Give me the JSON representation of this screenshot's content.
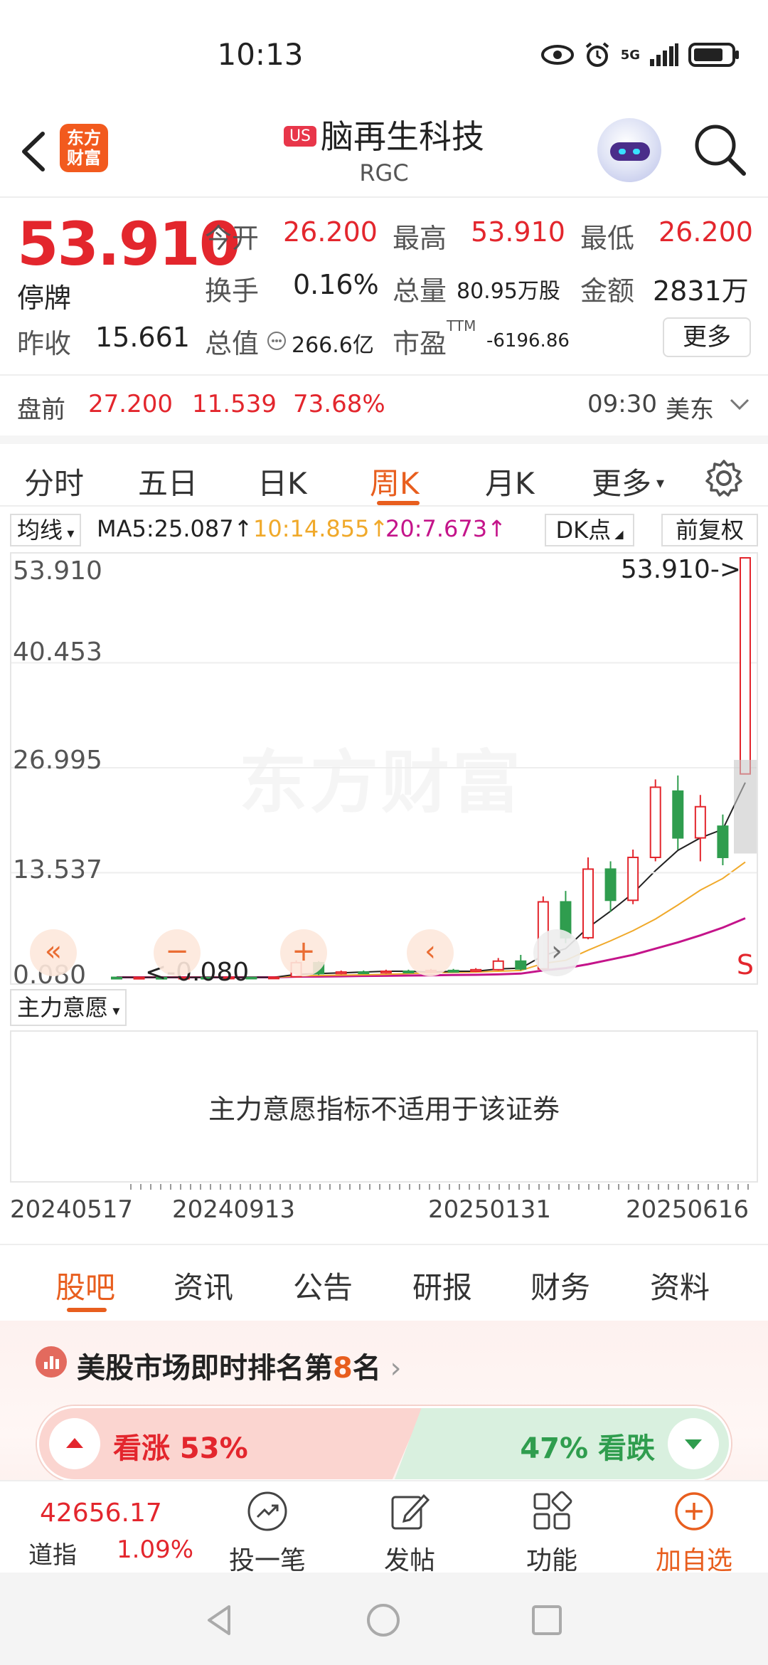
{
  "status": {
    "time": "10:13",
    "network": "5G"
  },
  "header": {
    "logo_text": "东方财富",
    "market_badge": "US",
    "name": "脑再生科技",
    "code": "RGC"
  },
  "quote": {
    "price": "53.910",
    "status": "停牌",
    "prev_close_label": "昨收",
    "prev_close": "15.661",
    "open_label": "今开",
    "open": "26.200",
    "high_label": "最高",
    "high": "53.910",
    "low_label": "最低",
    "low": "26.200",
    "turnover_label": "换手",
    "turnover": "0.16%",
    "volume_label": "总量",
    "volume": "80.95万股",
    "amount_label": "金额",
    "amount": "2831万",
    "mktcap_label": "总值",
    "mktcap": "266.6亿",
    "pe_label": "市盈",
    "pe_sup": "TTM",
    "pe": "-6196.86",
    "more": "更多"
  },
  "premarket": {
    "label": "盘前",
    "price": "27.200",
    "change": "11.539",
    "pct": "73.68%",
    "time": "09:30",
    "zone": "美东"
  },
  "period_tabs": [
    "分时",
    "五日",
    "日K",
    "周K",
    "月K",
    "更多"
  ],
  "ma": {
    "type": "均线",
    "ma5": "MA5:25.087↑",
    "ma10": "10:14.855↑",
    "ma20": "20:7.673↑",
    "dk": "DK点",
    "adjust": "前复权"
  },
  "chart_labels": {
    "watermark": "东方财富",
    "high_anno": "53.910->",
    "low_anno": "<-0.080",
    "signal": "S"
  },
  "chart_data": {
    "type": "candlestick",
    "title": "",
    "y_ticks": [
      "53.910",
      "40.453",
      "26.995",
      "13.537",
      "0.080"
    ],
    "ylim": [
      0.08,
      53.91
    ],
    "x_ticks": [
      "20240517",
      "20240913",
      "20250131",
      "20250616"
    ],
    "candles": [
      {
        "open": 0.12,
        "close": 0.1,
        "high": 0.15,
        "low": 0.08
      },
      {
        "open": 0.1,
        "close": 0.11,
        "high": 0.13,
        "low": 0.08
      },
      {
        "open": 0.11,
        "close": 0.1,
        "high": 0.13,
        "low": 0.09
      },
      {
        "open": 0.1,
        "close": 0.12,
        "high": 0.14,
        "low": 0.09
      },
      {
        "open": 0.12,
        "close": 0.11,
        "high": 0.14,
        "low": 0.1
      },
      {
        "open": 0.11,
        "close": 0.13,
        "high": 0.15,
        "low": 0.1
      },
      {
        "open": 0.13,
        "close": 0.12,
        "high": 0.15,
        "low": 0.11
      },
      {
        "open": 0.12,
        "close": 0.14,
        "high": 0.16,
        "low": 0.11
      },
      {
        "open": 0.2,
        "close": 2.0,
        "high": 2.3,
        "low": 0.1
      },
      {
        "open": 2.0,
        "close": 0.6,
        "high": 2.2,
        "low": 0.4
      },
      {
        "open": 0.6,
        "close": 0.8,
        "high": 1.0,
        "low": 0.5
      },
      {
        "open": 0.8,
        "close": 0.7,
        "high": 1.0,
        "low": 0.6
      },
      {
        "open": 0.7,
        "close": 0.9,
        "high": 1.1,
        "low": 0.6
      },
      {
        "open": 0.9,
        "close": 0.8,
        "high": 1.1,
        "low": 0.7
      },
      {
        "open": 0.8,
        "close": 1.0,
        "high": 1.2,
        "low": 0.7
      },
      {
        "open": 1.0,
        "close": 0.9,
        "high": 1.2,
        "low": 0.8
      },
      {
        "open": 0.9,
        "close": 1.1,
        "high": 1.3,
        "low": 0.8
      },
      {
        "open": 1.1,
        "close": 2.2,
        "high": 2.6,
        "low": 1.0
      },
      {
        "open": 2.2,
        "close": 1.2,
        "high": 3.0,
        "low": 1.0
      },
      {
        "open": 1.2,
        "close": 9.8,
        "high": 10.5,
        "low": 1.1
      },
      {
        "open": 9.8,
        "close": 5.2,
        "high": 11.2,
        "low": 4.5
      },
      {
        "open": 5.2,
        "close": 14.0,
        "high": 15.5,
        "low": 5.0
      },
      {
        "open": 14.0,
        "close": 10.0,
        "high": 15.0,
        "low": 8.5
      },
      {
        "open": 10.0,
        "close": 15.5,
        "high": 16.5,
        "low": 9.5
      },
      {
        "open": 15.5,
        "close": 24.5,
        "high": 25.5,
        "low": 15.0
      },
      {
        "open": 24.0,
        "close": 18.0,
        "high": 26.0,
        "low": 16.5
      },
      {
        "open": 18.0,
        "close": 22.0,
        "high": 23.5,
        "low": 15.0
      },
      {
        "open": 19.5,
        "close": 15.5,
        "high": 21.0,
        "low": 14.5
      },
      {
        "open": 26.2,
        "close": 53.91,
        "high": 53.91,
        "low": 26.2
      }
    ],
    "series": [
      {
        "name": "MA5",
        "color": "#222222",
        "values": [
          0.12,
          0.11,
          0.11,
          0.11,
          0.11,
          0.11,
          0.12,
          0.12,
          0.5,
          0.6,
          0.7,
          0.8,
          0.9,
          0.9,
          0.8,
          0.9,
          0.9,
          1.2,
          1.3,
          2.9,
          3.8,
          6.5,
          8.6,
          10.9,
          13.8,
          16.4,
          18.0,
          19.1,
          25.1
        ]
      },
      {
        "name": "MA10",
        "color": "#f0a92a",
        "values": [
          0.12,
          0.12,
          0.12,
          0.12,
          0.12,
          0.12,
          0.12,
          0.12,
          0.3,
          0.35,
          0.4,
          0.45,
          0.5,
          0.6,
          0.7,
          0.75,
          0.8,
          0.9,
          1.0,
          1.9,
          2.3,
          3.6,
          4.8,
          6.1,
          7.6,
          9.4,
          11.3,
          12.8,
          14.9
        ]
      },
      {
        "name": "MA20",
        "color": "#c4148a",
        "values": [
          0.12,
          0.12,
          0.12,
          0.12,
          0.12,
          0.12,
          0.12,
          0.12,
          0.2,
          0.22,
          0.25,
          0.3,
          0.32,
          0.35,
          0.38,
          0.42,
          0.45,
          0.5,
          0.6,
          1.0,
          1.3,
          1.8,
          2.4,
          3.0,
          3.8,
          4.6,
          5.5,
          6.5,
          7.7
        ]
      }
    ]
  },
  "indicator": {
    "select": "主力意愿",
    "message": "主力意愿指标不适用于该证券"
  },
  "content_tabs": [
    "股吧",
    "资讯",
    "公告",
    "研报",
    "财务",
    "资料"
  ],
  "rank": {
    "prefix": "美股市场即时排名第",
    "num": "8",
    "suffix": "名"
  },
  "vote": {
    "up": "看涨 53%",
    "down": "47% 看跌"
  },
  "bottom": {
    "index_value": "42656.17",
    "index_name": "道指",
    "index_change": "1.09%",
    "items": [
      "投一笔",
      "发帖",
      "功能",
      "加自选"
    ]
  },
  "colors": {
    "up": "#e3262d",
    "down": "#2f9d4e",
    "accent": "#e85e1e"
  }
}
